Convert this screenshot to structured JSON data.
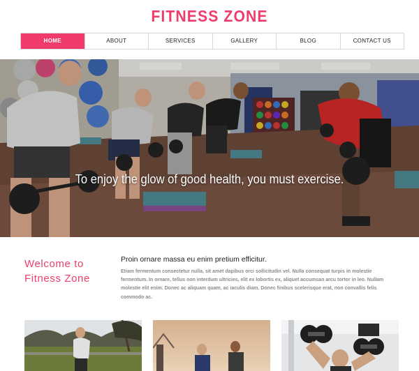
{
  "site": {
    "title": "FITNESS ZONE"
  },
  "nav": {
    "items": [
      {
        "label": "HOME",
        "active": true
      },
      {
        "label": "ABOUT",
        "active": false
      },
      {
        "label": "SERVICES",
        "active": false
      },
      {
        "label": "GALLERY",
        "active": false
      },
      {
        "label": "BLOG",
        "active": false
      },
      {
        "label": "CONTACT US",
        "active": false
      }
    ]
  },
  "hero": {
    "caption": "To enjoy the glow of good health, you must exercise."
  },
  "welcome": {
    "title_line1": "Welcome to",
    "title_line2": "Fitness Zone",
    "heading": "Proin ornare massa eu enim pretium efficitur.",
    "body": "Etiam fermentum consectetur nulla, sit amet dapibus orci sollicitudin vel. Nulla consequat turpis in molestie fermentum. In ornare, tellus non interdum ultricies, elit ex lobortis ex, aliquet accumsan arcu tortor in leo. Nullam molestie elit enim. Donec ac aliquam quam, ac iaculis diam. Donec finibus scelerisque erat, non convallis felis commodo ac."
  },
  "colors": {
    "accent": "#ef3d6b",
    "nav_active_bg": "#f03a69",
    "body_text": "#8a8a8a"
  }
}
